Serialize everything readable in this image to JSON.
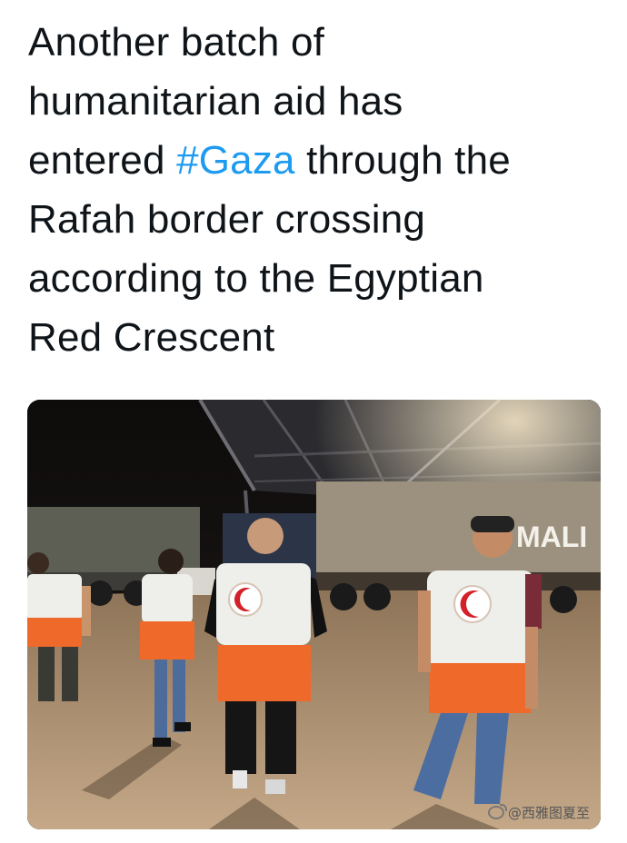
{
  "tweet": {
    "line1": "Another batch of",
    "line2": "humanitarian aid has",
    "line3_before": "entered ",
    "hashtag": "#Gaza",
    "line3_after": " through the",
    "line4": "Rafah border crossing",
    "line5": "according to the Egyptian",
    "line6": "Red Crescent"
  },
  "photo": {
    "truck_sign_text": "MALI"
  },
  "watermark": {
    "text": "@西雅图夏至"
  },
  "colors": {
    "hashtag": "#1d9bf0",
    "vest_orange": "#ef6a2a",
    "vest_white": "#eeeeea"
  }
}
